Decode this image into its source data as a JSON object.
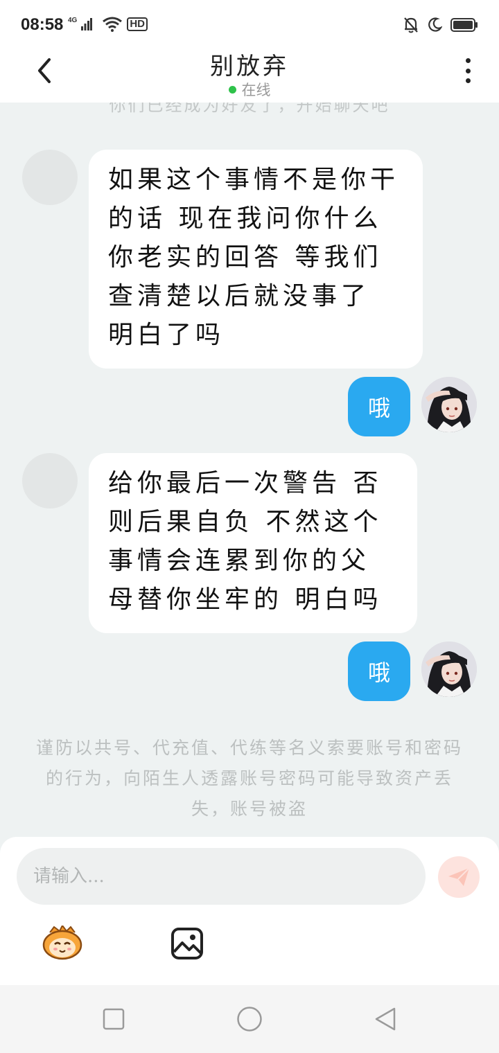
{
  "status_bar": {
    "time": "08:58",
    "network": "4G",
    "hd": "HD"
  },
  "header": {
    "title": "别放弃",
    "status": "在线"
  },
  "chat": {
    "system_top": "你们已经成为好友了，开始聊天吧",
    "messages": [
      {
        "side": "left",
        "text": "如果这个事情不是你干的话 现在我问你什么 你老实的回答 等我们查清楚以后就没事了 明白了吗"
      },
      {
        "side": "right",
        "text": "哦"
      },
      {
        "side": "left",
        "text": "给你最后一次警告 否则后果自负 不然这个事情会连累到你的父母替你坐牢的 明白吗"
      },
      {
        "side": "right",
        "text": "哦"
      }
    ],
    "system_bottom": "谨防以共号、代充值、代练等名义索要账号和密码的行为，向陌生人透露账号密码可能导致资产丢失，账号被盗"
  },
  "composer": {
    "placeholder": "请输入..."
  },
  "colors": {
    "accent_blue": "#2aa9f0",
    "online_green": "#2ec24a",
    "send_disabled": "#fde3de",
    "background": "#eef2f2"
  },
  "icons": [
    "back-icon",
    "more-icon",
    "send-icon",
    "emoji-icon",
    "image-icon",
    "recent-apps-icon",
    "home-icon",
    "nav-back-icon"
  ]
}
